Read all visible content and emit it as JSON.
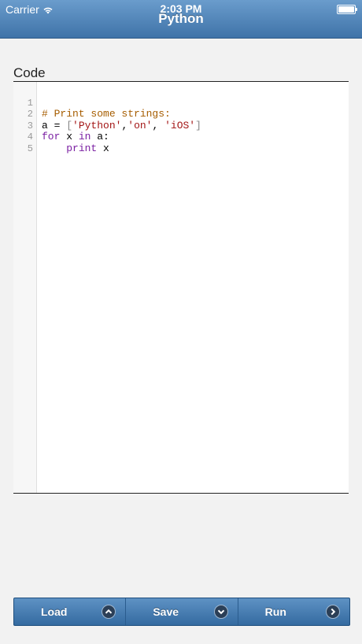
{
  "status_bar": {
    "carrier": "Carrier",
    "time": "2:03 PM"
  },
  "nav": {
    "title": "Python"
  },
  "code_section": {
    "label": "Code"
  },
  "editor": {
    "lines": [
      {
        "number": "1",
        "text": "# Print some strings:"
      },
      {
        "number": "2",
        "text": "a = ['Python','on', 'iOS']"
      },
      {
        "number": "3",
        "text": "for x in a:"
      },
      {
        "number": "4",
        "text": "    print x"
      },
      {
        "number": "5",
        "text": ""
      }
    ]
  },
  "toolbar": {
    "load_label": "Load",
    "save_label": "Save",
    "run_label": "Run",
    "load_icon": "chevron-up-icon",
    "save_icon": "chevron-down-icon",
    "run_icon": "chevron-right-icon"
  },
  "colors": {
    "nav_bar": "#4a7fb3",
    "comment": "#a65d00",
    "keyword": "#7a1fa2",
    "string": "#a31515"
  }
}
